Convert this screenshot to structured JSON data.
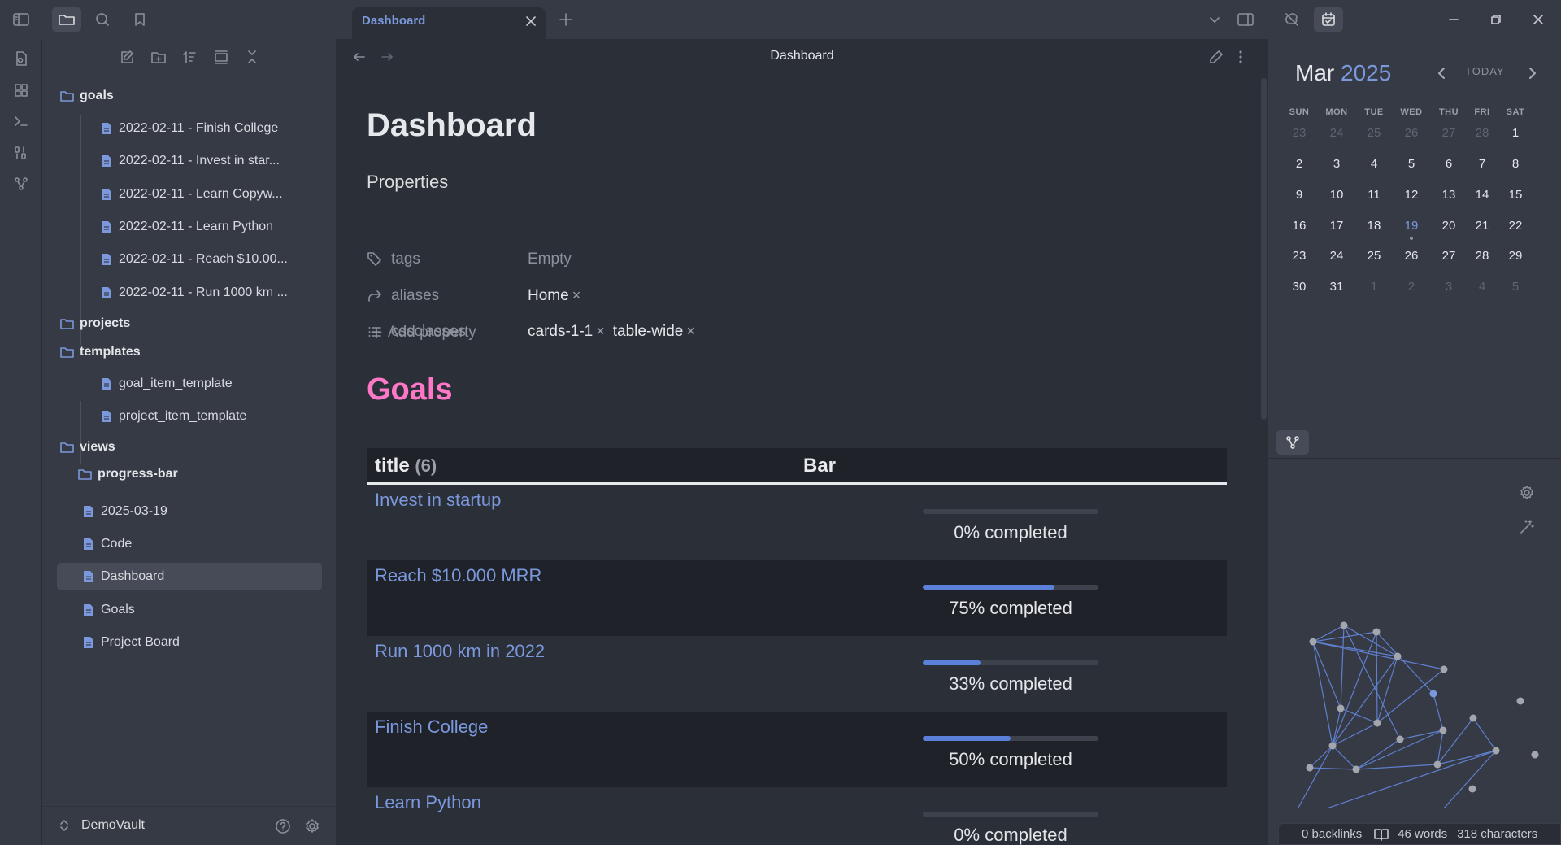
{
  "tab": {
    "title": "Dashboard"
  },
  "explorer": {
    "items": [
      {
        "label": "goals"
      },
      {
        "label": "2022-02-11 - Finish College"
      },
      {
        "label": "2022-02-11 - Invest in star..."
      },
      {
        "label": "2022-02-11 - Learn Copyw..."
      },
      {
        "label": "2022-02-11 - Learn Python"
      },
      {
        "label": "2022-02-11 - Reach $10.00..."
      },
      {
        "label": "2022-02-11 - Run 1000 km ..."
      },
      {
        "label": "projects"
      },
      {
        "label": "templates"
      },
      {
        "label": "goal_item_template"
      },
      {
        "label": "project_item_template"
      },
      {
        "label": "views"
      },
      {
        "label": "progress-bar"
      },
      {
        "label": "2025-03-19"
      },
      {
        "label": "Code"
      },
      {
        "label": "Dashboard"
      },
      {
        "label": "Goals"
      },
      {
        "label": "Project Board"
      }
    ],
    "vault_name": "DemoVault"
  },
  "doc": {
    "header_title": "Dashboard",
    "h1": "Dashboard",
    "properties_heading": "Properties",
    "properties": [
      {
        "key": "tags",
        "value": "Empty"
      },
      {
        "key": "aliases",
        "values": [
          "Home"
        ]
      },
      {
        "key": "cssclasses",
        "values": [
          "cards-1-1",
          "table-wide"
        ]
      }
    ],
    "remove_mark": "×",
    "add_property": "Add property",
    "goals_heading": "Goals",
    "table": {
      "col_title": "title",
      "count": "(6)",
      "col_bar": "Bar",
      "rows": [
        {
          "title": "Invest in startup",
          "progress": 0,
          "label": "0% completed"
        },
        {
          "title": "Reach $10.000 MRR",
          "progress": 75,
          "label": "75% completed"
        },
        {
          "title": "Run 1000 km in 2022",
          "progress": 33,
          "label": "33% completed"
        },
        {
          "title": "Finish College",
          "progress": 50,
          "label": "50% completed"
        },
        {
          "title": "Learn Python",
          "progress": 0,
          "label": "0% completed"
        }
      ]
    }
  },
  "calendar": {
    "month": "Mar",
    "year": "2025",
    "today_label": "TODAY",
    "dow": [
      "SUN",
      "MON",
      "TUE",
      "WED",
      "THU",
      "FRI",
      "SAT"
    ],
    "weeks": [
      [
        "23",
        "24",
        "25",
        "26",
        "27",
        "28",
        "1"
      ],
      [
        "2",
        "3",
        "4",
        "5",
        "6",
        "7",
        "8"
      ],
      [
        "9",
        "10",
        "11",
        "12",
        "13",
        "14",
        "15"
      ],
      [
        "16",
        "17",
        "18",
        "19",
        "20",
        "21",
        "22"
      ],
      [
        "23",
        "24",
        "25",
        "26",
        "27",
        "28",
        "29"
      ],
      [
        "30",
        "31",
        "1",
        "2",
        "3",
        "4",
        "5"
      ]
    ],
    "today": "19"
  },
  "status": {
    "backlinks": "0 backlinks",
    "words": "46 words",
    "characters": "318 characters"
  },
  "colors": {
    "accent": "#7b98dd",
    "goals_heading": "#ff78c8",
    "progress_fill": "#5b80d9"
  }
}
